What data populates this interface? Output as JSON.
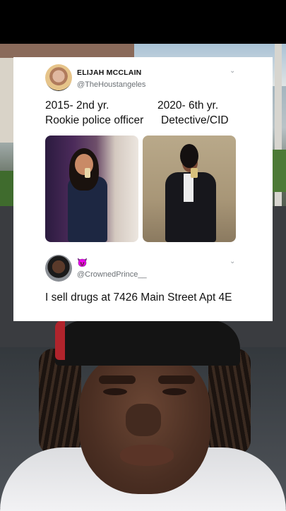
{
  "tweet1": {
    "author_name": "ELIJAH MCCLAIN",
    "handle": "@TheHoustangeles",
    "line_left_1": "2015- 2nd yr.",
    "line_right_1": "2020- 6th yr.",
    "line_left_2": "Rookie police officer",
    "line_right_2": "Detective/CID",
    "menu_icon": "chevron-down-icon"
  },
  "tweet2": {
    "emoji": "😈",
    "handle": "@CrownedPrince__",
    "text": "I sell drugs at 7426 Main Street Apt 4E",
    "menu_icon": "chevron-down-icon"
  },
  "colors": {
    "card_bg": "#ffffff",
    "handle_gray": "#6b7075",
    "text": "#111111"
  }
}
